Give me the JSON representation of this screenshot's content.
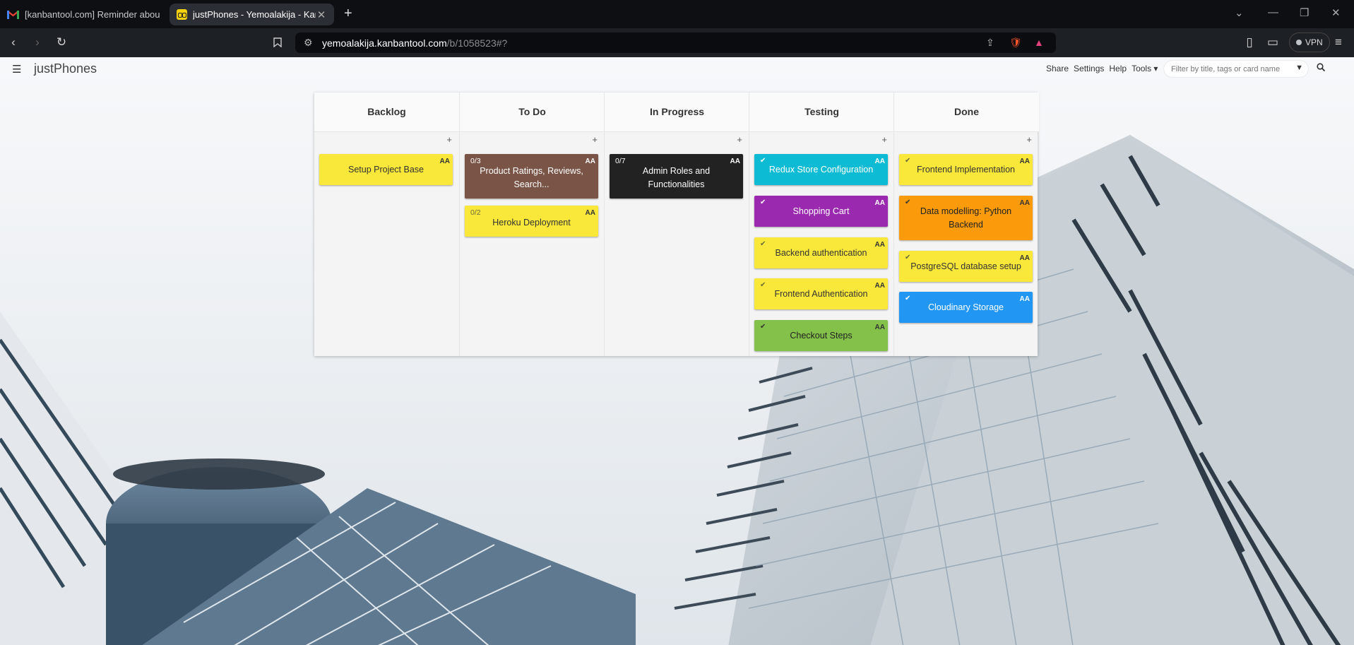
{
  "browser": {
    "tabs": [
      {
        "title": "[kanbantool.com] Reminder about an",
        "icon": "gmail-icon",
        "active": false
      },
      {
        "title": "justPhones - Yemoalakija - Kanban",
        "icon": "kanbantool-icon",
        "active": true
      }
    ],
    "url_host": "yemoalakija.kanbantool.com",
    "url_path": "/b/1058523#?",
    "vpn_label": "VPN"
  },
  "board": {
    "name": "justPhones",
    "links": [
      "Share",
      "Settings",
      "Help",
      "Tools ▾"
    ],
    "filter_placeholder": "Filter by title, tags or card name",
    "columns": [
      {
        "title": "Backlog",
        "cards": [
          {
            "title": "Setup Project Base",
            "color": "yellow",
            "meta": "",
            "done": false,
            "badge": "AA"
          }
        ]
      },
      {
        "title": "To Do",
        "cards": [
          {
            "title": "Product Ratings, Reviews, Search...",
            "color": "brown",
            "meta": "0/3",
            "done": false,
            "badge": "AA"
          },
          {
            "title": "Heroku Deployment",
            "color": "yellow",
            "meta": "0/2",
            "done": false,
            "badge": "AA"
          }
        ]
      },
      {
        "title": "In Progress",
        "cards": [
          {
            "title": "Admin Roles and Functionalities",
            "color": "black",
            "meta": "0/7",
            "done": false,
            "badge": "AA"
          }
        ]
      },
      {
        "title": "Testing",
        "cards": [
          {
            "title": "Redux Store Configuration",
            "color": "cyan",
            "meta": "",
            "done": true,
            "badge": "AA"
          },
          {
            "title": "Shopping Cart",
            "color": "purple",
            "meta": "",
            "done": true,
            "badge": "AA"
          },
          {
            "title": "Backend authentication",
            "color": "yellow",
            "meta": "",
            "done": true,
            "badge": "AA"
          },
          {
            "title": "Frontend Authentication",
            "color": "yellow",
            "meta": "",
            "done": true,
            "badge": "AA"
          },
          {
            "title": "Checkout Steps",
            "color": "green",
            "meta": "",
            "done": true,
            "badge": "AA"
          }
        ]
      },
      {
        "title": "Done",
        "cards": [
          {
            "title": "Frontend Implementation",
            "color": "yellow",
            "meta": "",
            "done": true,
            "badge": "AA"
          },
          {
            "title": "Data modelling: Python Backend",
            "color": "orange",
            "meta": "",
            "done": true,
            "badge": "AA"
          },
          {
            "title": "PostgreSQL database setup",
            "color": "yellow",
            "meta": "",
            "done": true,
            "badge": "AA"
          },
          {
            "title": "Cloudinary Storage",
            "color": "blue",
            "meta": "",
            "done": true,
            "badge": "AA"
          }
        ]
      }
    ]
  },
  "colors": {
    "yellow": "#f9e83a",
    "brown": "#7a5446",
    "black": "#222222",
    "cyan": "#0dbcd4",
    "purple": "#9b29b0",
    "green": "#84c14a",
    "orange": "#fb9a0b",
    "blue": "#2196f3"
  }
}
